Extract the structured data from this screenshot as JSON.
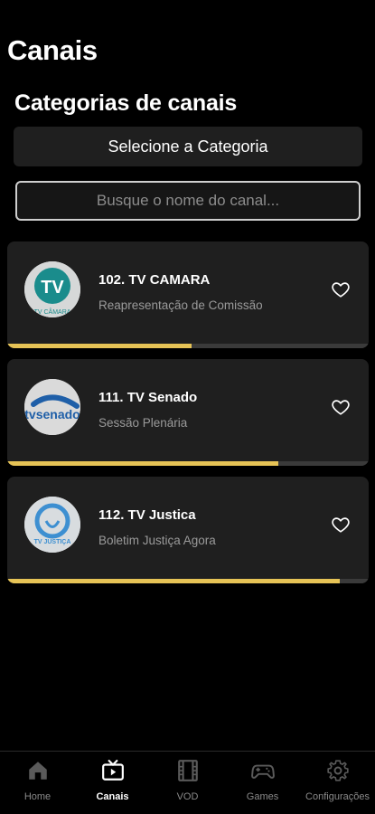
{
  "header": {
    "title": "Canais"
  },
  "categories": {
    "title": "Categorias de canais",
    "select_label": "Selecione a Categoria"
  },
  "search": {
    "placeholder": "Busque o nome do canal..."
  },
  "channels": [
    {
      "name": "102. TV CAMARA",
      "program": "Reapresentação de Comissão",
      "progress": 0.51,
      "logo_text": "TV CÂMARA",
      "logo_icon": "tv-camara-logo"
    },
    {
      "name": "111. TV Senado",
      "program": "Sessão Plenária",
      "progress": 0.75,
      "logo_text": "tvsenado",
      "logo_icon": "tv-senado-logo"
    },
    {
      "name": "112. TV Justica",
      "program": "Boletim Justiça Agora",
      "progress": 0.92,
      "logo_text": "TV JUSTIÇA",
      "logo_icon": "tv-justica-logo"
    }
  ],
  "bottom_nav": {
    "items": [
      {
        "label": "Home",
        "icon": "home-icon",
        "active": false
      },
      {
        "label": "Canais",
        "icon": "tv-play-icon",
        "active": true
      },
      {
        "label": "VOD",
        "icon": "film-icon",
        "active": false
      },
      {
        "label": "Games",
        "icon": "gamepad-icon",
        "active": false
      },
      {
        "label": "Configurações",
        "icon": "gear-icon",
        "active": false
      }
    ]
  },
  "colors": {
    "background": "#000000",
    "card": "#1f1f1f",
    "progress": "#e6c356",
    "muted_text": "#9a9a9a"
  }
}
